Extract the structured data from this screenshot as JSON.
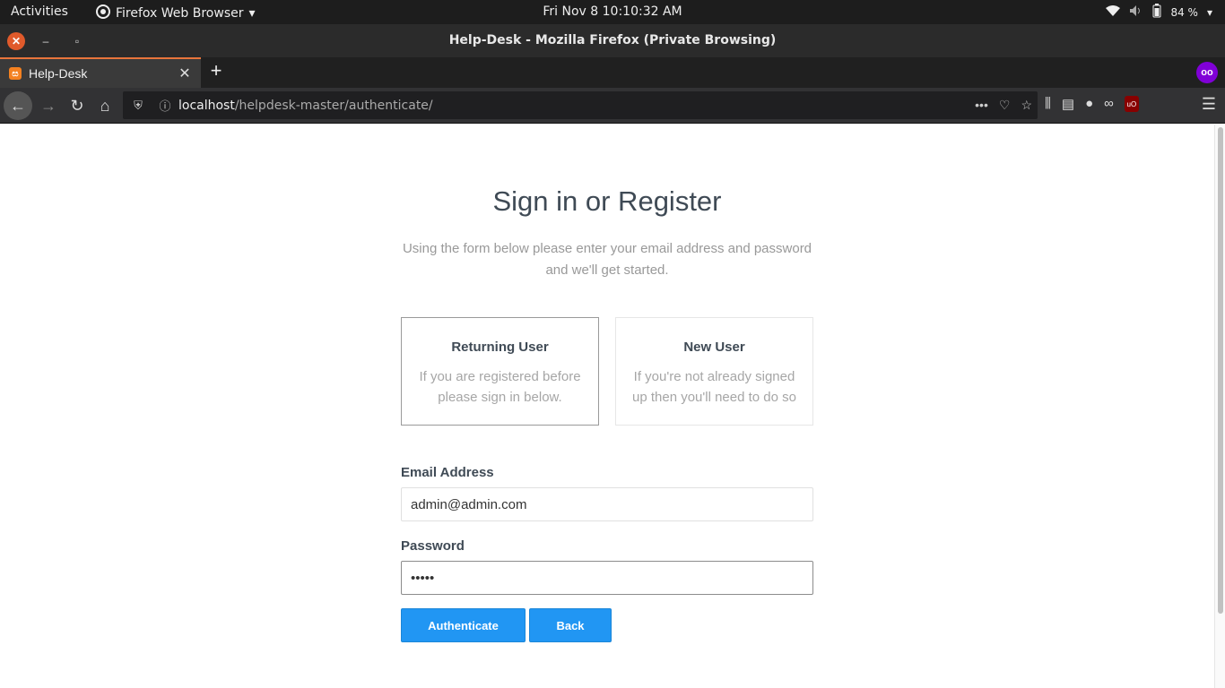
{
  "system_bar": {
    "activities": "Activities",
    "app_name": "Firefox Web Browser",
    "clock": "Fri Nov 8  10:10:32 AM",
    "battery": "84 %"
  },
  "window": {
    "title": "Help-Desk - Mozilla Firefox (Private Browsing)"
  },
  "tabs": [
    {
      "label": "Help-Desk"
    }
  ],
  "navbar": {
    "url_host": "localhost",
    "url_path": "/helpdesk-master/authenticate/"
  },
  "page": {
    "heading": "Sign in or Register",
    "subtext": "Using the form below please enter your email address and password and we'll get started.",
    "cards": [
      {
        "title": "Returning User",
        "description": "If you are registered before please sign in below."
      },
      {
        "title": "New User",
        "description": "If you're not already signed up then you'll need to do so"
      }
    ],
    "email_label": "Email Address",
    "email_value": "admin@admin.com",
    "password_label": "Password",
    "password_value": "admin",
    "authenticate_label": "Authenticate",
    "back_label": "Back"
  }
}
